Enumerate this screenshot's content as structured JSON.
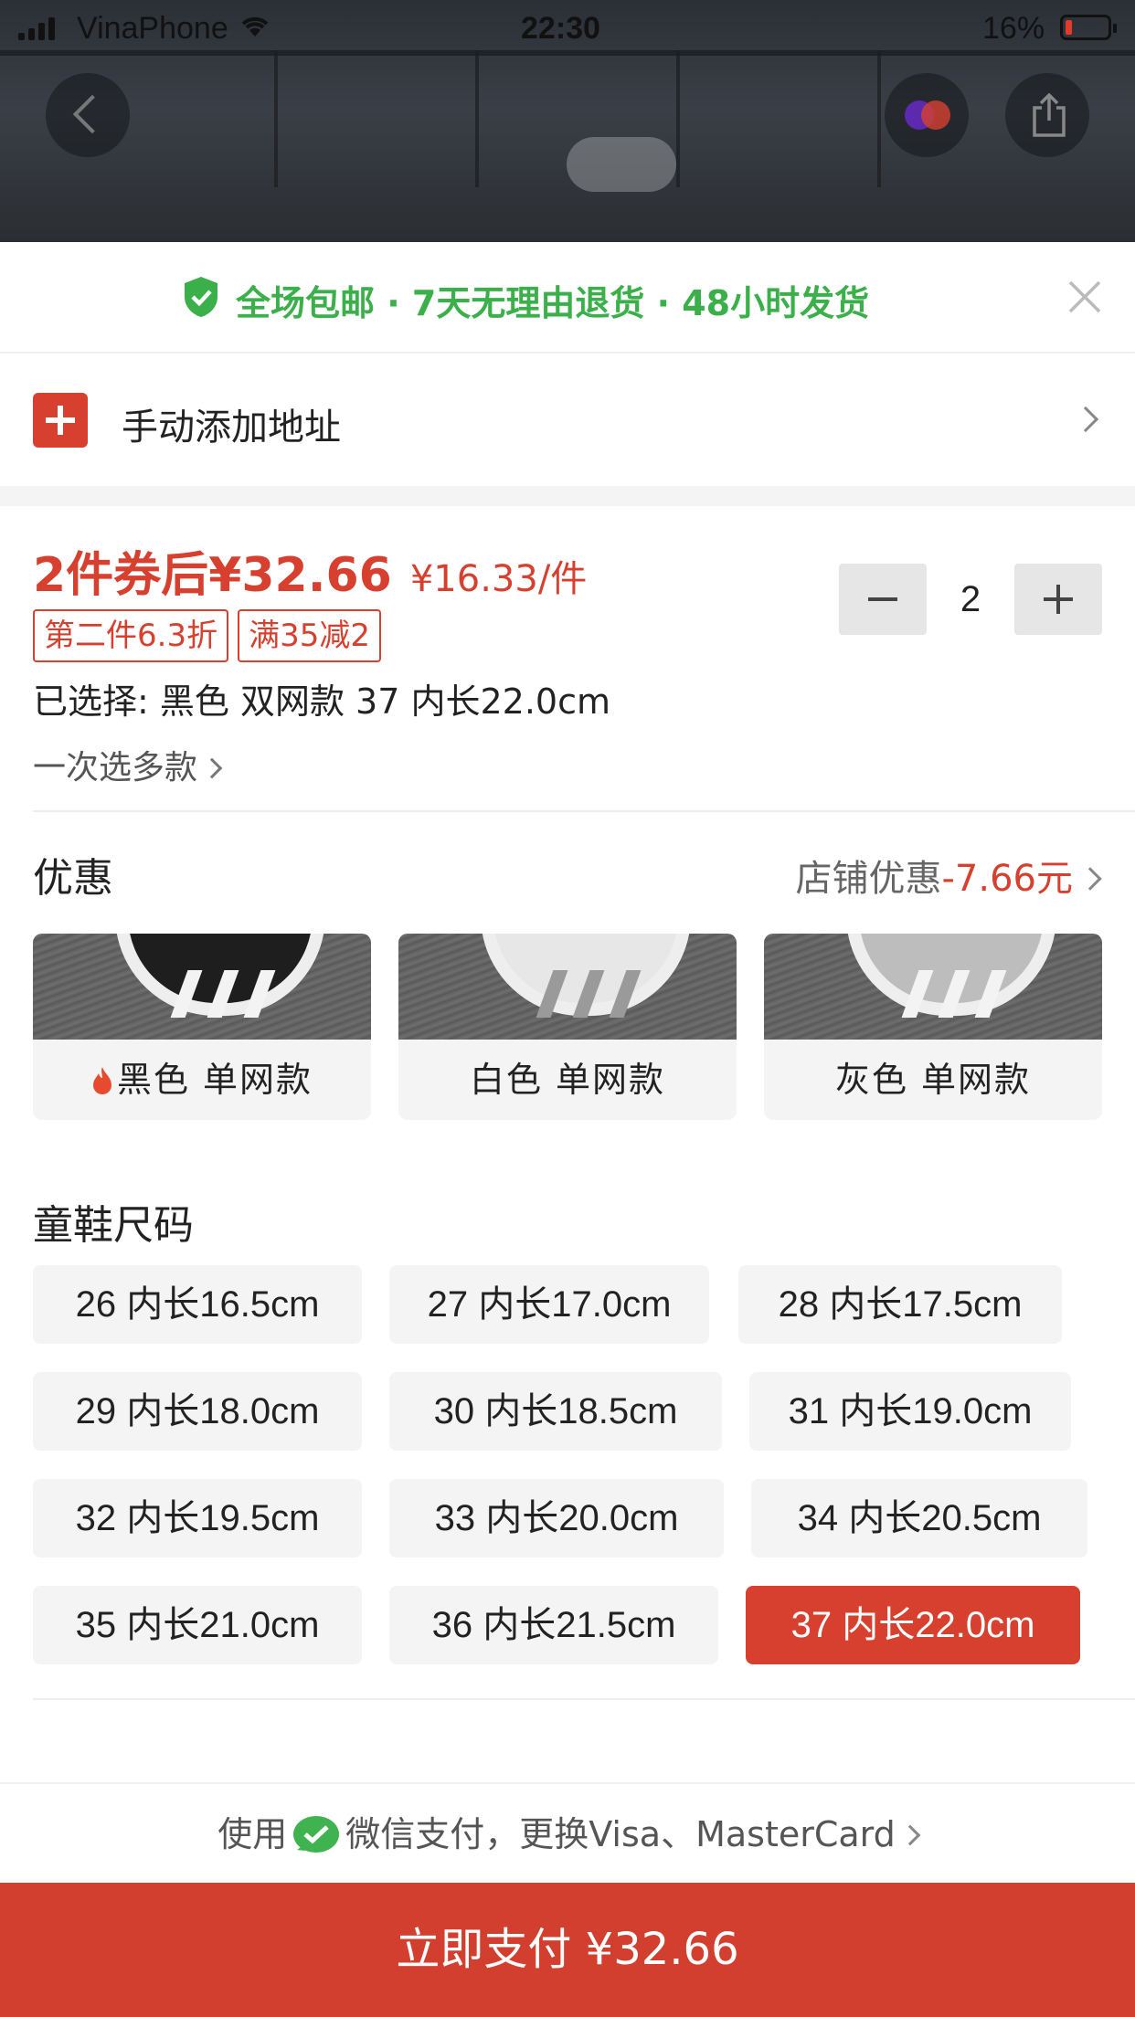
{
  "status_bar": {
    "carrier": "VinaPhone",
    "time": "22:30",
    "battery": "16%"
  },
  "promo": {
    "text": "全场包邮 · 7天无理由退货 · 48小时发货"
  },
  "address": {
    "label": "手动添加地址"
  },
  "price": {
    "main": "2件券后¥32.66",
    "unit": "¥16.33/件",
    "quantity": "2"
  },
  "tags": [
    "第二件6.3折",
    "满35减2"
  ],
  "selection": {
    "selected": "已选择: 黑色 双网款 37 内长22.0cm",
    "multi": "一次选多款"
  },
  "discount": {
    "title": "优惠",
    "label": "店铺优惠",
    "amount": "-7.66元"
  },
  "colors": [
    {
      "label": "黑色 单网款",
      "hot": true
    },
    {
      "label": "白色 单网款",
      "hot": false
    },
    {
      "label": "灰色 单网款",
      "hot": false
    }
  ],
  "size_title": "童鞋尺码",
  "sizes": [
    {
      "label": "26 内长16.5cm"
    },
    {
      "label": "27 内长17.0cm"
    },
    {
      "label": "28 内长17.5cm"
    },
    {
      "label": "29 内长18.0cm"
    },
    {
      "label": "30 内长18.5cm"
    },
    {
      "label": "31 内长19.0cm"
    },
    {
      "label": "32 内长19.5cm"
    },
    {
      "label": "33 内长20.0cm"
    },
    {
      "label": "34 内长20.5cm"
    },
    {
      "label": "35 内长21.0cm"
    },
    {
      "label": "36 内长21.5cm"
    },
    {
      "label": "37 内长22.0cm",
      "selected": true
    }
  ],
  "payment": {
    "prefix": "使用",
    "method": "微信支付，更换Visa、MasterCard",
    "button": "立即支付 ¥32.66"
  },
  "colors_theme": {
    "accent": "#d7402f",
    "promo_green": "#3bb04a",
    "wechat_green": "#3fb34f"
  },
  "icons": {
    "back": "chevron-left-icon",
    "brand": "brand-logo-icon",
    "share": "share-icon",
    "promo": "shield-check-icon",
    "close": "close-icon",
    "add": "plus-icon",
    "hot": "flame-icon",
    "wechat": "wechat-pay-icon"
  }
}
